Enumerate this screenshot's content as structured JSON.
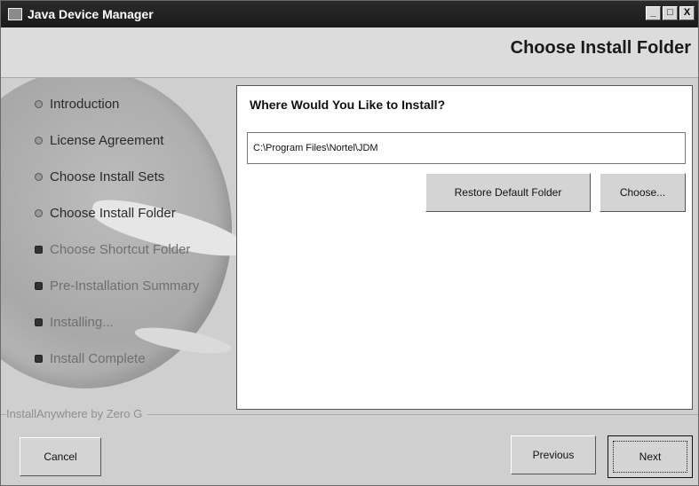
{
  "window": {
    "title": "Java Device Manager",
    "controls": {
      "minimize": "_",
      "maximize": "□",
      "close": "X"
    }
  },
  "header": {
    "page_title": "Choose Install Folder"
  },
  "steps": [
    {
      "label": "Introduction",
      "state": "done"
    },
    {
      "label": "License Agreement",
      "state": "done"
    },
    {
      "label": "Choose Install Sets",
      "state": "done"
    },
    {
      "label": "Choose Install Folder",
      "state": "current"
    },
    {
      "label": "Choose Shortcut Folder",
      "state": "future"
    },
    {
      "label": "Pre-Installation Summary",
      "state": "future"
    },
    {
      "label": "Installing...",
      "state": "future"
    },
    {
      "label": "Install Complete",
      "state": "future"
    }
  ],
  "content": {
    "question": "Where Would You Like to Install?",
    "install_path": "C:\\Program Files\\Nortel\\JDM",
    "restore_label": "Restore Default Folder",
    "choose_label": "Choose..."
  },
  "footer": {
    "brand": "InstallAnywhere by Zero G",
    "cancel_label": "Cancel",
    "previous_label": "Previous",
    "next_label": "Next"
  }
}
